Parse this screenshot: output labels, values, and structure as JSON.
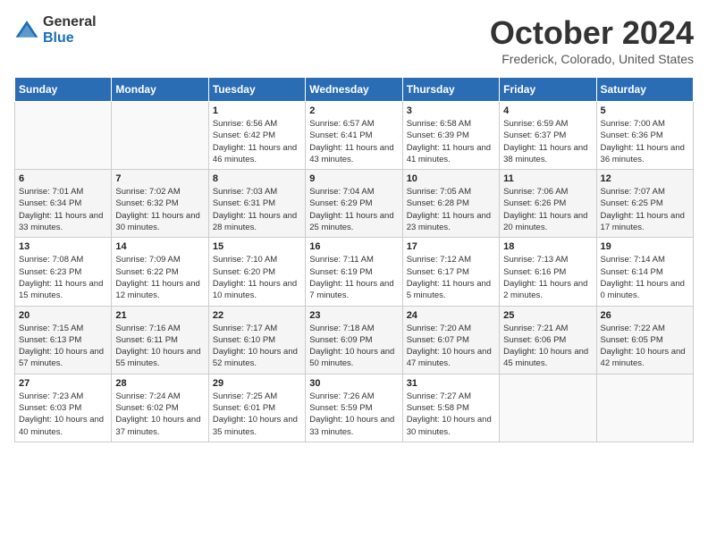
{
  "header": {
    "logo_general": "General",
    "logo_blue": "Blue",
    "month": "October 2024",
    "location": "Frederick, Colorado, United States"
  },
  "weekdays": [
    "Sunday",
    "Monday",
    "Tuesday",
    "Wednesday",
    "Thursday",
    "Friday",
    "Saturday"
  ],
  "weeks": [
    [
      {
        "day": "",
        "sunrise": "",
        "sunset": "",
        "daylight": ""
      },
      {
        "day": "",
        "sunrise": "",
        "sunset": "",
        "daylight": ""
      },
      {
        "day": "1",
        "sunrise": "Sunrise: 6:56 AM",
        "sunset": "Sunset: 6:42 PM",
        "daylight": "Daylight: 11 hours and 46 minutes."
      },
      {
        "day": "2",
        "sunrise": "Sunrise: 6:57 AM",
        "sunset": "Sunset: 6:41 PM",
        "daylight": "Daylight: 11 hours and 43 minutes."
      },
      {
        "day": "3",
        "sunrise": "Sunrise: 6:58 AM",
        "sunset": "Sunset: 6:39 PM",
        "daylight": "Daylight: 11 hours and 41 minutes."
      },
      {
        "day": "4",
        "sunrise": "Sunrise: 6:59 AM",
        "sunset": "Sunset: 6:37 PM",
        "daylight": "Daylight: 11 hours and 38 minutes."
      },
      {
        "day": "5",
        "sunrise": "Sunrise: 7:00 AM",
        "sunset": "Sunset: 6:36 PM",
        "daylight": "Daylight: 11 hours and 36 minutes."
      }
    ],
    [
      {
        "day": "6",
        "sunrise": "Sunrise: 7:01 AM",
        "sunset": "Sunset: 6:34 PM",
        "daylight": "Daylight: 11 hours and 33 minutes."
      },
      {
        "day": "7",
        "sunrise": "Sunrise: 7:02 AM",
        "sunset": "Sunset: 6:32 PM",
        "daylight": "Daylight: 11 hours and 30 minutes."
      },
      {
        "day": "8",
        "sunrise": "Sunrise: 7:03 AM",
        "sunset": "Sunset: 6:31 PM",
        "daylight": "Daylight: 11 hours and 28 minutes."
      },
      {
        "day": "9",
        "sunrise": "Sunrise: 7:04 AM",
        "sunset": "Sunset: 6:29 PM",
        "daylight": "Daylight: 11 hours and 25 minutes."
      },
      {
        "day": "10",
        "sunrise": "Sunrise: 7:05 AM",
        "sunset": "Sunset: 6:28 PM",
        "daylight": "Daylight: 11 hours and 23 minutes."
      },
      {
        "day": "11",
        "sunrise": "Sunrise: 7:06 AM",
        "sunset": "Sunset: 6:26 PM",
        "daylight": "Daylight: 11 hours and 20 minutes."
      },
      {
        "day": "12",
        "sunrise": "Sunrise: 7:07 AM",
        "sunset": "Sunset: 6:25 PM",
        "daylight": "Daylight: 11 hours and 17 minutes."
      }
    ],
    [
      {
        "day": "13",
        "sunrise": "Sunrise: 7:08 AM",
        "sunset": "Sunset: 6:23 PM",
        "daylight": "Daylight: 11 hours and 15 minutes."
      },
      {
        "day": "14",
        "sunrise": "Sunrise: 7:09 AM",
        "sunset": "Sunset: 6:22 PM",
        "daylight": "Daylight: 11 hours and 12 minutes."
      },
      {
        "day": "15",
        "sunrise": "Sunrise: 7:10 AM",
        "sunset": "Sunset: 6:20 PM",
        "daylight": "Daylight: 11 hours and 10 minutes."
      },
      {
        "day": "16",
        "sunrise": "Sunrise: 7:11 AM",
        "sunset": "Sunset: 6:19 PM",
        "daylight": "Daylight: 11 hours and 7 minutes."
      },
      {
        "day": "17",
        "sunrise": "Sunrise: 7:12 AM",
        "sunset": "Sunset: 6:17 PM",
        "daylight": "Daylight: 11 hours and 5 minutes."
      },
      {
        "day": "18",
        "sunrise": "Sunrise: 7:13 AM",
        "sunset": "Sunset: 6:16 PM",
        "daylight": "Daylight: 11 hours and 2 minutes."
      },
      {
        "day": "19",
        "sunrise": "Sunrise: 7:14 AM",
        "sunset": "Sunset: 6:14 PM",
        "daylight": "Daylight: 11 hours and 0 minutes."
      }
    ],
    [
      {
        "day": "20",
        "sunrise": "Sunrise: 7:15 AM",
        "sunset": "Sunset: 6:13 PM",
        "daylight": "Daylight: 10 hours and 57 minutes."
      },
      {
        "day": "21",
        "sunrise": "Sunrise: 7:16 AM",
        "sunset": "Sunset: 6:11 PM",
        "daylight": "Daylight: 10 hours and 55 minutes."
      },
      {
        "day": "22",
        "sunrise": "Sunrise: 7:17 AM",
        "sunset": "Sunset: 6:10 PM",
        "daylight": "Daylight: 10 hours and 52 minutes."
      },
      {
        "day": "23",
        "sunrise": "Sunrise: 7:18 AM",
        "sunset": "Sunset: 6:09 PM",
        "daylight": "Daylight: 10 hours and 50 minutes."
      },
      {
        "day": "24",
        "sunrise": "Sunrise: 7:20 AM",
        "sunset": "Sunset: 6:07 PM",
        "daylight": "Daylight: 10 hours and 47 minutes."
      },
      {
        "day": "25",
        "sunrise": "Sunrise: 7:21 AM",
        "sunset": "Sunset: 6:06 PM",
        "daylight": "Daylight: 10 hours and 45 minutes."
      },
      {
        "day": "26",
        "sunrise": "Sunrise: 7:22 AM",
        "sunset": "Sunset: 6:05 PM",
        "daylight": "Daylight: 10 hours and 42 minutes."
      }
    ],
    [
      {
        "day": "27",
        "sunrise": "Sunrise: 7:23 AM",
        "sunset": "Sunset: 6:03 PM",
        "daylight": "Daylight: 10 hours and 40 minutes."
      },
      {
        "day": "28",
        "sunrise": "Sunrise: 7:24 AM",
        "sunset": "Sunset: 6:02 PM",
        "daylight": "Daylight: 10 hours and 37 minutes."
      },
      {
        "day": "29",
        "sunrise": "Sunrise: 7:25 AM",
        "sunset": "Sunset: 6:01 PM",
        "daylight": "Daylight: 10 hours and 35 minutes."
      },
      {
        "day": "30",
        "sunrise": "Sunrise: 7:26 AM",
        "sunset": "Sunset: 5:59 PM",
        "daylight": "Daylight: 10 hours and 33 minutes."
      },
      {
        "day": "31",
        "sunrise": "Sunrise: 7:27 AM",
        "sunset": "Sunset: 5:58 PM",
        "daylight": "Daylight: 10 hours and 30 minutes."
      },
      {
        "day": "",
        "sunrise": "",
        "sunset": "",
        "daylight": ""
      },
      {
        "day": "",
        "sunrise": "",
        "sunset": "",
        "daylight": ""
      }
    ]
  ]
}
